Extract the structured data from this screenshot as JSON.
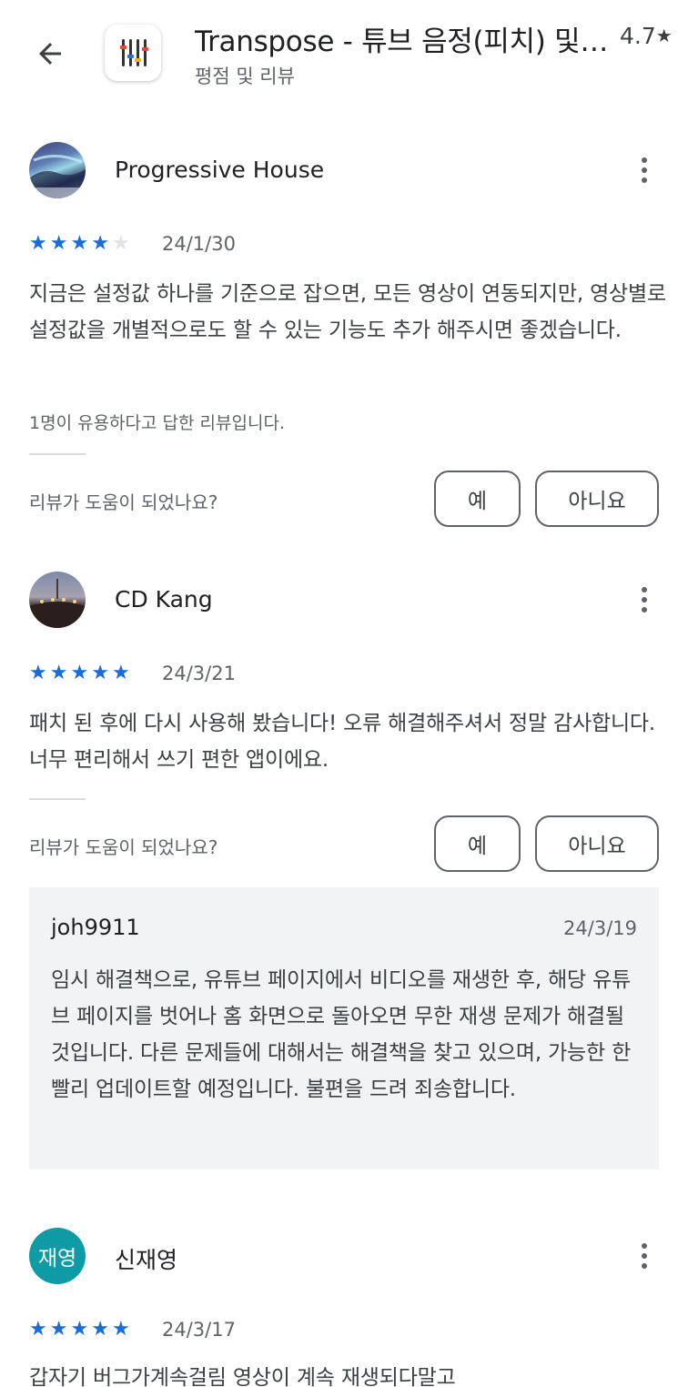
{
  "header": {
    "app_title": "Transpose - 튜브 음정(피치) 및 ...",
    "subtitle": "평점 및 리뷰",
    "rating": "4.7",
    "rating_star": "★"
  },
  "reviews": [
    {
      "name": "Progressive House",
      "stars": 4,
      "date": "24/1/30",
      "text": "지금은 설정값 하나를 기준으로 잡으면, 모든 영상이 연동되지만, 영상별로 설정값을 개별적으로도 할 수 있는 기능도 추가 해주시면 좋겠습니다.",
      "helpful_count": "1명이 유용하다고 답한 리뷰입니다.",
      "helpful_question": "리뷰가 도움이 되었나요?",
      "yes_label": "예",
      "no_label": "아니요"
    },
    {
      "name": "CD Kang",
      "stars": 5,
      "date": "24/3/21",
      "text": "패치 된 후에 다시 사용해 봤습니다! 오류 해결해주셔서 정말 감사합니다. 너무 편리해서 쓰기 편한 앱이에요.",
      "helpful_question": "리뷰가 도움이 되었나요?",
      "yes_label": "예",
      "no_label": "아니요",
      "developer_reply": {
        "name": "joh9911",
        "date": "24/3/19",
        "text": "임시 해결책으로, 유튜브 페이지에서 비디오를 재생한 후, 해당 유튜브 페이지를 벗어나 홈 화면으로 돌아오면 무한 재생 문제가 해결될 것입니다. 다른 문제들에 대해서는 해결책을 찾고 있으며, 가능한 한 빨리 업데이트할 예정입니다. 불편을 드려 죄송합니다."
      }
    },
    {
      "name": "신재영",
      "avatar_initials": "재영",
      "stars": 5,
      "date": "24/3/17",
      "text": "갑자기 버그가계속걸림 영상이 계속 재생되다말고"
    }
  ],
  "colors": {
    "star_on": "#1a6dd9",
    "star_off": "#e3e3e3",
    "avatar_teal": "#0e9ba5"
  }
}
